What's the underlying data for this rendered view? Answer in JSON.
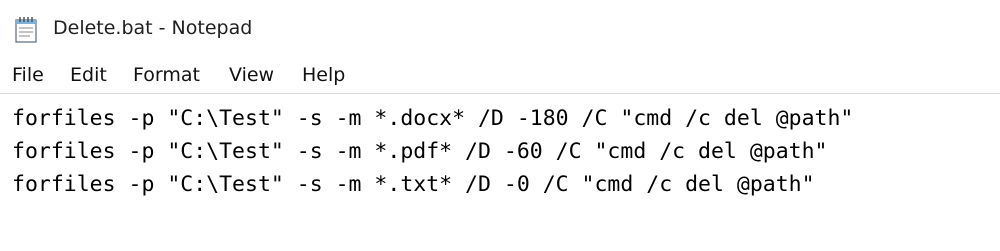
{
  "window": {
    "title": "Delete.bat - Notepad",
    "icon": "notepad-icon"
  },
  "menu": {
    "items": [
      "File",
      "Edit",
      "Format",
      "View",
      "Help"
    ]
  },
  "editor": {
    "lines": [
      "forfiles -p \"C:\\Test\" -s -m *.docx* /D -180 /C \"cmd /c del @path\"",
      "forfiles -p \"C:\\Test\" -s -m *.pdf* /D -60 /C \"cmd /c del @path\"",
      "forfiles -p \"C:\\Test\" -s -m *.txt* /D -0 /C \"cmd /c del @path\""
    ]
  }
}
